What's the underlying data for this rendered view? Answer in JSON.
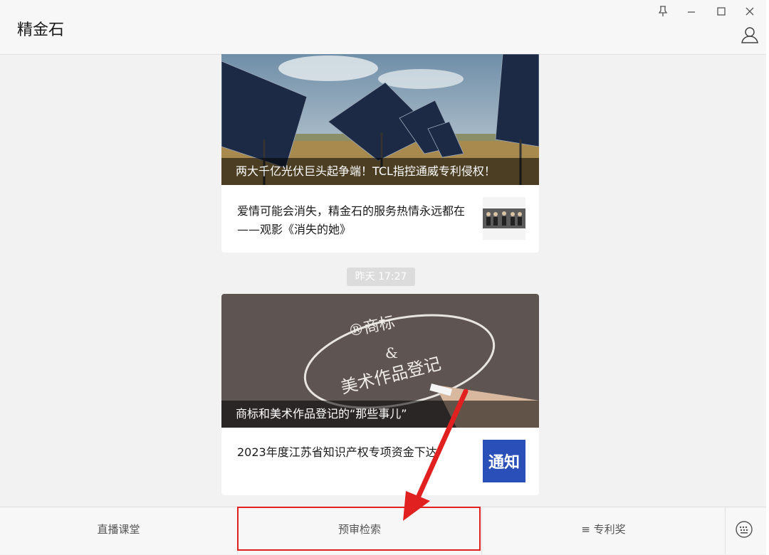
{
  "app": {
    "title": "精金石"
  },
  "window_controls": [
    {
      "name": "pin-icon",
      "glyph": "⊤"
    },
    {
      "name": "minimize-icon",
      "glyph": "—"
    },
    {
      "name": "maximize-icon",
      "glyph": "□"
    },
    {
      "name": "close-icon",
      "glyph": "✕"
    }
  ],
  "feed": {
    "article_group_1": {
      "hero_caption": "两大千亿光伏巨头起争端！TCL指控通威专利侵权！",
      "sub_item": {
        "title": "爱情可能会消失，精金石的服务热情永远都在——观影《消失的她》"
      }
    },
    "timestamp": "昨天 17:27",
    "article_group_2": {
      "hero_caption": "商标和美术作品登记的“那些事儿”",
      "hero_image_text": [
        "®商标",
        "&",
        "美术作品登记"
      ],
      "sub_item": {
        "title": "2023年度江苏省知识产权专项资金下达",
        "thumb_text": "通知"
      }
    }
  },
  "bottom_menu": {
    "items": [
      {
        "label": "直播课堂"
      },
      {
        "label": "预审检索"
      },
      {
        "label": "≡ 专利奖"
      }
    ],
    "keyboard_icon": "keyboard-icon"
  },
  "colors": {
    "annotation": "#e12020",
    "timestamp_bg": "#dcdcdc",
    "thumb_blue": "#2a4fb8"
  }
}
